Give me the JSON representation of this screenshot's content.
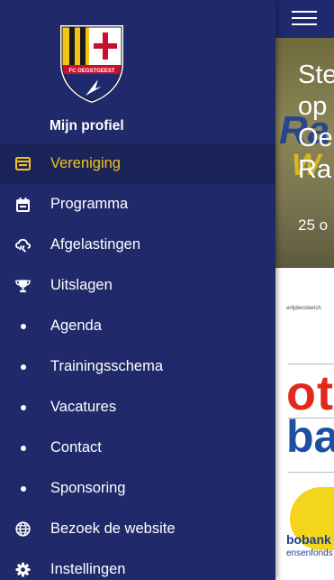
{
  "drawer": {
    "profile_label": "Mijn profiel",
    "logo_text": "FC OEGSTGEEST",
    "active_color": "#f2c21b",
    "background_color": "#202a6b",
    "items": [
      {
        "label": "Vereniging",
        "icon": "club-card-icon",
        "active": true
      },
      {
        "label": "Programma",
        "icon": "calendar-icon",
        "active": false
      },
      {
        "label": "Afgelastingen",
        "icon": "cloud-rain-icon",
        "active": false
      },
      {
        "label": "Uitslagen",
        "icon": "trophy-icon",
        "active": false
      },
      {
        "label": "Agenda",
        "icon": "bullet-icon",
        "active": false
      },
      {
        "label": "Trainingsschema",
        "icon": "bullet-icon",
        "active": false
      },
      {
        "label": "Vacatures",
        "icon": "bullet-icon",
        "active": false
      },
      {
        "label": "Contact",
        "icon": "bullet-icon",
        "active": false
      },
      {
        "label": "Sponsoring",
        "icon": "bullet-icon",
        "active": false
      },
      {
        "label": "Bezoek de website",
        "icon": "globe-icon",
        "active": false
      },
      {
        "label": "Instellingen",
        "icon": "gear-icon",
        "active": false
      }
    ]
  },
  "background_page": {
    "menu_icon": "hamburger-menu-icon",
    "hero": {
      "title_lines": [
        "Ste",
        "op",
        "Oe",
        "Ra"
      ],
      "date": "25 o",
      "deco_blue": "Ra",
      "deco_yellow": "W"
    },
    "banner": {
      "small_text": "erlijdensberich",
      "red_text": "ote",
      "blue_text": "ba",
      "bottom_text": "bobank",
      "bottom_sub": "ensenfonds"
    }
  }
}
